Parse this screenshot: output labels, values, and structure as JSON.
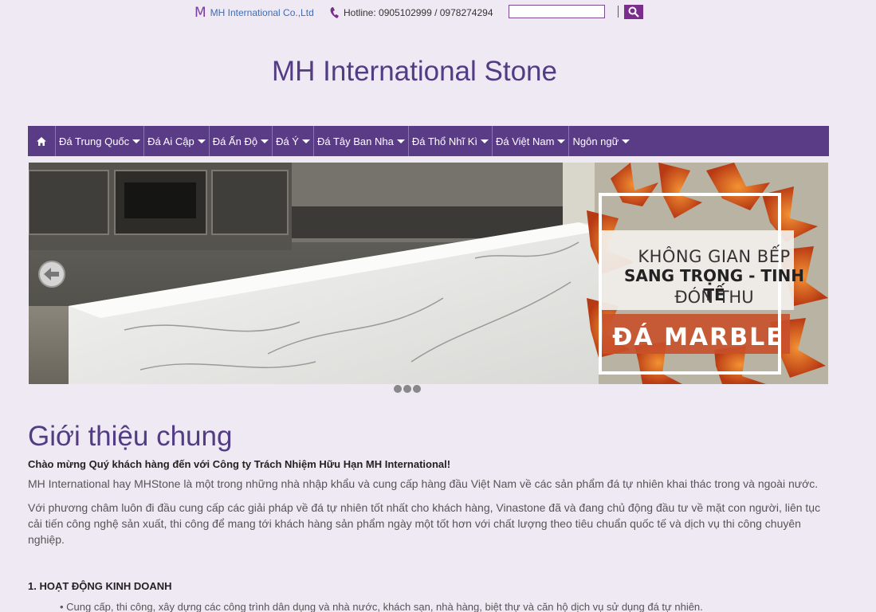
{
  "topbar": {
    "logo_letter": "M",
    "company_name": "MH International Co.,Ltd",
    "hotline": "Hotline: 0905102999 / 0978274294",
    "search_placeholder": "",
    "search_icon": "search-icon"
  },
  "site_title": "MH International Stone",
  "nav": {
    "home_icon": "home-icon",
    "items": [
      {
        "label": "Đá Trung Quốc"
      },
      {
        "label": "Đá Ai Cập"
      },
      {
        "label": "Đá Ấn Độ"
      },
      {
        "label": "Đá Ý"
      },
      {
        "label": "Đá Tây Ban Nha"
      },
      {
        "label": "Đá Thổ Nhĩ Kì"
      },
      {
        "label": "Đá Việt Nam"
      },
      {
        "label": "Ngôn ngữ"
      }
    ]
  },
  "slider": {
    "promo_line1": "KHÔNG GIAN BẾP",
    "promo_line2": "SANG TRỌNG - TINH TẾ",
    "promo_line3": "ĐÓN THU",
    "promo_line4": "ĐÁ MARBLE",
    "dot_count": 3
  },
  "intro": {
    "title": "Giới thiệu chung",
    "welcome": "Chào mừng Quý khách hàng đến với Công ty Trách Nhiệm Hữu Hạn MH International!",
    "para1": "MH International hay MHStone là một trong những nhà nhập khẩu và cung cấp hàng đầu Việt Nam về các sản phẩm đá tự nhiên khai thác trong và ngoài nước.",
    "para2": "Với phương châm luôn đi đầu cung cấp các giải pháp về đá tự nhiên tốt nhất cho khách hàng, Vinastone đã và đang chủ động đầu tư về mặt con người, liên tục cải tiến công nghệ sản xuất, thi công để mang tới khách hàng sản phẩm ngày một tốt hơn với chất lượng theo tiêu chuẩn quốc tế và dịch vụ thi công chuyên nghiệp.",
    "heading1": "1. HOẠT ĐỘNG KINH DOANH",
    "bullet1": "• Cung cấp, thi công, xây dựng các công trình dân dụng và nhà nước, khách sạn, nhà hàng, biệt thự và căn hộ dịch vụ sử dụng đá tự nhiên."
  },
  "colors": {
    "brand_purple": "#5a3c86",
    "title_purple": "#523c84",
    "background": "#efe9f3"
  }
}
